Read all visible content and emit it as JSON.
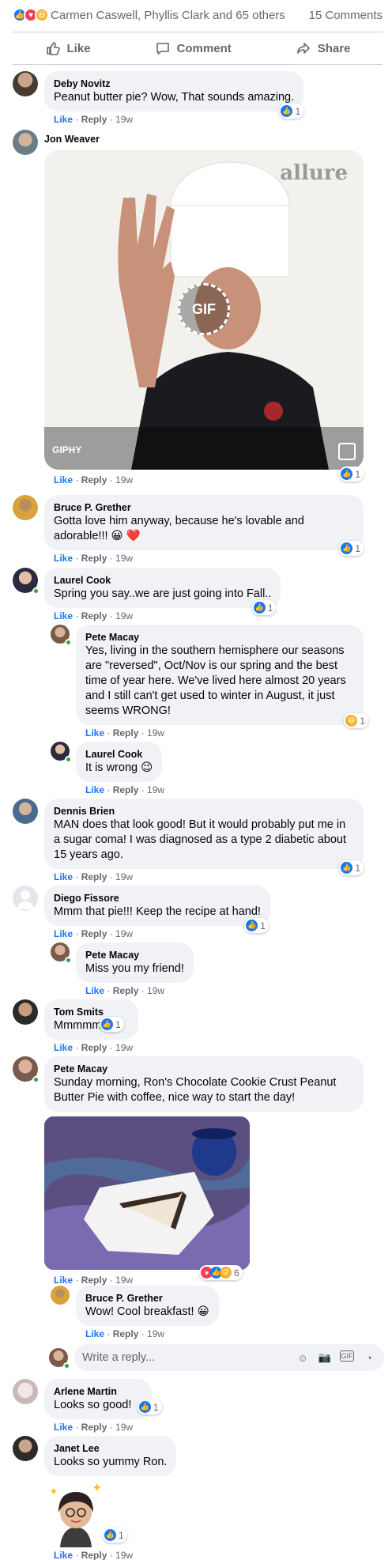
{
  "summary": {
    "reactors": "Carmen Caswell, Phyllis Clark and 65 others",
    "comments_count": "15 Comments"
  },
  "actions": {
    "like": "Like",
    "comment": "Comment",
    "share": "Share"
  },
  "meta_labels": {
    "like": "Like",
    "reply": "Reply"
  },
  "comments": [
    {
      "author": "Deby Novitz",
      "text": "Peanut butter pie? Wow, That sounds amazing.",
      "time": "19w",
      "reactions": "1"
    },
    {
      "author": "Jon Weaver",
      "text": "",
      "time": "19w",
      "reactions": "1",
      "gif": {
        "brand": "allure",
        "badge": "GIF",
        "attribution": "GIPHY"
      }
    },
    {
      "author": "Bruce P. Grether",
      "text": "Gotta love him anyway, because he's lovable and adorable!!! 😀 ❤️",
      "time": "19w",
      "reactions": "1"
    },
    {
      "author": "Laurel Cook",
      "text": "Spring you say..we are just going into Fall..",
      "time": "19w",
      "reactions": "1"
    },
    {
      "author": "Pete Macay",
      "text": "Yes, living in the southern hemisphere our seasons are \"reversed\", Oct/Nov is our spring and the best time of year here. We've lived here almost 20 years and I still can't get used to winter in August, it just seems WRONG!",
      "time": "19w",
      "reactions": "1"
    },
    {
      "author": "Laurel Cook",
      "text": "It is wrong 😉",
      "time": "19w"
    },
    {
      "author": "Dennis Brien",
      "text": "MAN does that look good! But it would probably put me in a sugar coma! I was diagnosed as a type 2 diabetic about 15 years ago.",
      "time": "19w",
      "reactions": "1"
    },
    {
      "author": "Diego Fissore",
      "text": "Mmm that pie!!! Keep the recipe at hand!",
      "time": "19w",
      "reactions": "1"
    },
    {
      "author": "Pete Macay",
      "text": "Miss you my friend!",
      "time": "19w"
    },
    {
      "author": "Tom Smits",
      "text": "Mmmmm",
      "time": "19w",
      "reactions": "1"
    },
    {
      "author": "Pete Macay",
      "text": "Sunday morning, Ron's Chocolate Cookie Crust Peanut Butter Pie with coffee, nice way to start the day!",
      "time": "19w",
      "reactions": "6"
    },
    {
      "author": "Bruce P. Grether",
      "text": "Wow! Cool breakfast! 😀",
      "time": "19w"
    },
    {
      "author": "Arlene Martin",
      "text": "Looks so good!",
      "time": "19w",
      "reactions": "1"
    },
    {
      "author": "Janet Lee",
      "text": "Looks so yummy Ron.",
      "time": "19w",
      "reactions": "1"
    }
  ],
  "reply_box": {
    "placeholder": "Write a reply..."
  },
  "icons": {
    "like": "thumbs-up-icon",
    "comment": "speech-bubble-icon",
    "share": "share-arrow-icon",
    "emoji": "smiley-icon",
    "camera": "camera-icon",
    "gif": "gif-icon",
    "sticker": "sticker-icon"
  },
  "colors": {
    "accent": "#1877f2",
    "bubble": "#f0f2f5",
    "muted": "#65676b",
    "online": "#31a24c"
  }
}
